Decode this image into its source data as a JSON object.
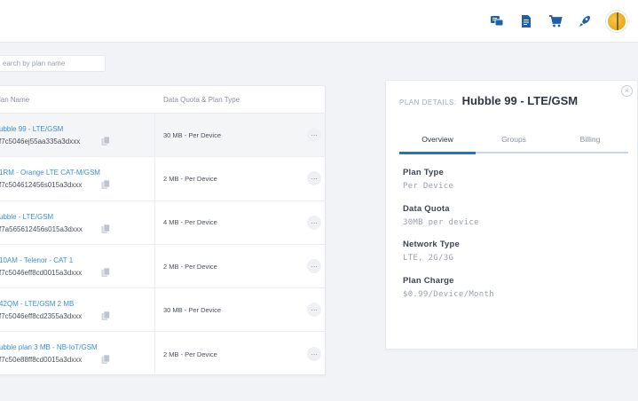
{
  "header": {
    "icons": [
      "chat-icon",
      "document-icon",
      "cart-icon",
      "rocket-icon",
      "user-avatar"
    ]
  },
  "search": {
    "placeholder": "earch by plan name"
  },
  "table": {
    "columns": {
      "name": "lan Name",
      "quota": "Data Quota & Plan Type"
    },
    "rows": [
      {
        "title": "ubble 99 - LTE/GSM",
        "id": "f7c5046ej55aa335a3dxxx",
        "quota": "30 MB - Per Device",
        "selected": true
      },
      {
        "title": "1RM - Orange LTE CAT-M/GSM",
        "id": "f7c504612456s015a3dxxx",
        "quota": "2 MB - Per Device",
        "selected": false
      },
      {
        "title": "ubble - LTE/GSM",
        "id": "f7a565612456s015a3dxxx",
        "quota": "4 MB - Per Device",
        "selected": false
      },
      {
        "title": "10AM - Telenor - CAT 1",
        "id": "f7c5046eff8cd0015a3dxxx",
        "quota": "2 MB - Per Device",
        "selected": false
      },
      {
        "title": "42QM - LTE/GSM 2 MB",
        "id": "f7c5046eff8cd2355a3dxxx",
        "quota": "30 MB - Per Device",
        "selected": false
      },
      {
        "title": "ubble plan 3 MB - NB-IoT/GSM",
        "id": "f7c50e88ff8cd0015a3dxxx",
        "quota": "2 MB - Per Device",
        "selected": false
      }
    ],
    "more_label": "···"
  },
  "details": {
    "kicker": "PLAN DETAILS:",
    "title": "Hubble 99 - LTE/GSM",
    "close": "×",
    "tabs": [
      {
        "label": "Overview",
        "active": true
      },
      {
        "label": "Groups",
        "active": false
      },
      {
        "label": "Billing",
        "active": false
      }
    ],
    "fields": [
      {
        "label": "Plan Type",
        "value": "Per Device"
      },
      {
        "label": "Data Quota",
        "value": "30MB per device"
      },
      {
        "label": "Network Type",
        "value": "LTE, 2G/3G"
      },
      {
        "label": "Plan Charge",
        "value": "$0.99/Device/Month"
      }
    ]
  },
  "colors": {
    "accent": "#2d6fb8",
    "link": "#3b8fd9"
  }
}
